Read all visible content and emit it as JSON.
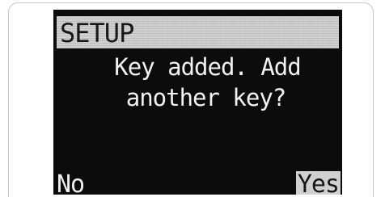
{
  "title_bar": {
    "title": "SETUP"
  },
  "message": {
    "line1": "Key added. Add",
    "line2": "another key?"
  },
  "softkeys": {
    "left_label": "No",
    "right_label": "Yes"
  },
  "colors": {
    "screen_background": "#0c0c0c",
    "title_bar_background": "#cfcfcf",
    "text": "#f2f2f2",
    "selected_softkey_background": "#d0d0d0"
  }
}
